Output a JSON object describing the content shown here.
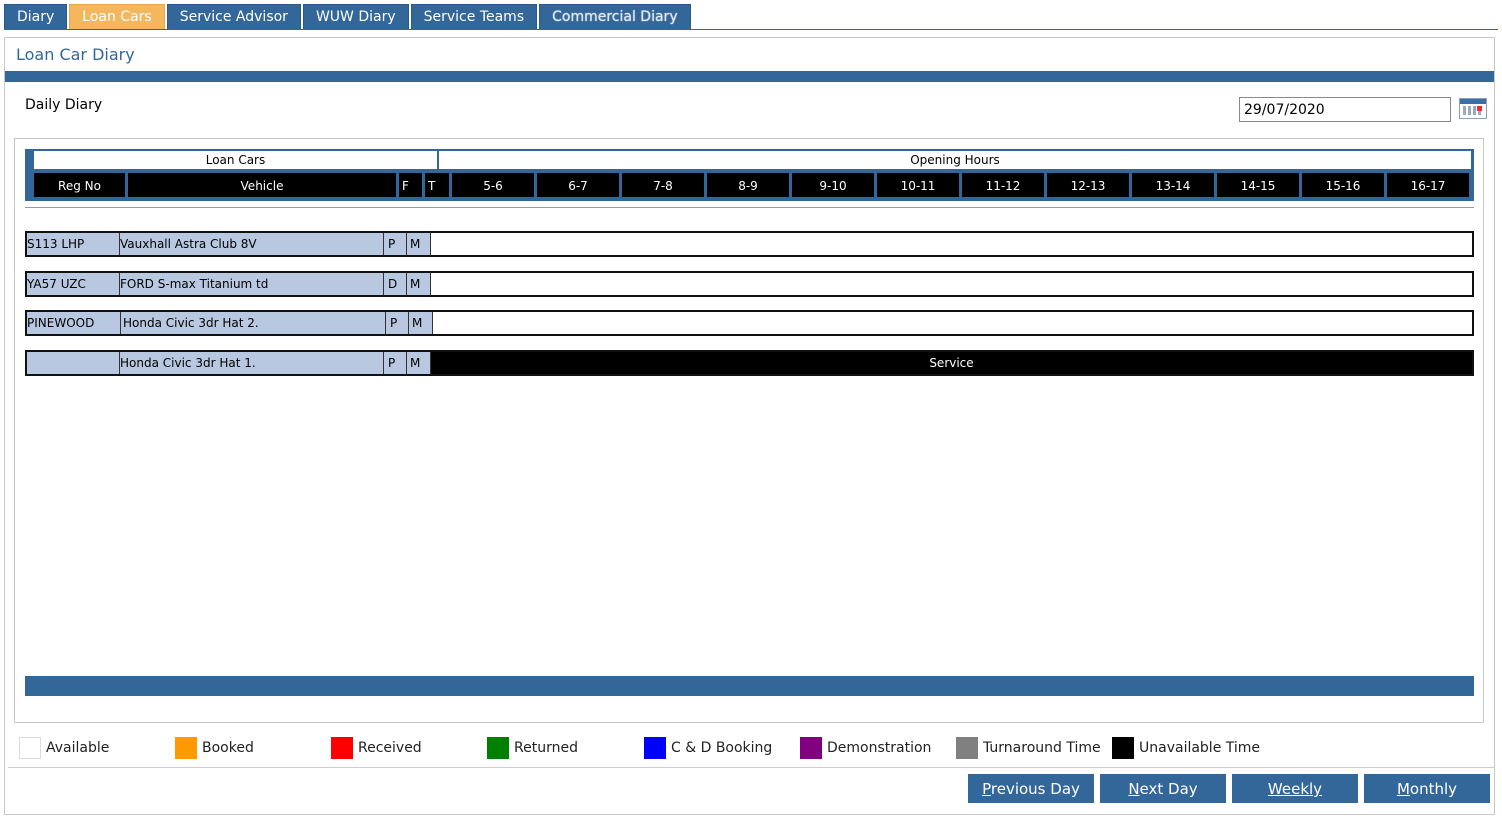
{
  "tabs": [
    {
      "label": "Diary",
      "active": false
    },
    {
      "label": "Loan Cars",
      "active": true
    },
    {
      "label": "Service Advisor",
      "active": false
    },
    {
      "label": "WUW Diary",
      "active": false
    },
    {
      "label": "Service Teams",
      "active": false
    },
    {
      "label": "Commercial Diary",
      "active": false
    }
  ],
  "page_title": "Loan Car Diary",
  "daily_label": "Daily Diary",
  "date_value": "29/07/2020",
  "header": {
    "group_loan_cars": "Loan Cars",
    "group_opening_hours": "Opening Hours",
    "columns": {
      "reg_no": "Reg No",
      "vehicle": "Vehicle",
      "f": "F",
      "t": "T"
    },
    "hours": [
      "5-6",
      "6-7",
      "7-8",
      "8-9",
      "9-10",
      "10-11",
      "11-12",
      "12-13",
      "13-14",
      "14-15",
      "15-16",
      "16-17"
    ]
  },
  "rows": [
    {
      "reg": "S113 LHP",
      "vehicle": "Vauxhall Astra Club 8V",
      "f": "P",
      "t": "M",
      "booking": ""
    },
    {
      "reg": "YA57 UZC",
      "vehicle": "FORD S-max Titanium td",
      "f": "D",
      "t": "M",
      "booking": ""
    },
    {
      "reg": "PINEWOOD",
      "vehicle": "Honda Civic 3dr Hat 2.",
      "f": "P",
      "t": "M",
      "booking": ""
    },
    {
      "reg": "",
      "vehicle": "Honda Civic 3dr Hat 1.",
      "f": "P",
      "t": "M",
      "booking": "Service"
    }
  ],
  "legend": [
    {
      "label": "Available",
      "color": "#ffffff"
    },
    {
      "label": "Booked",
      "color": "#ff9900"
    },
    {
      "label": "Received",
      "color": "#ff0000"
    },
    {
      "label": "Returned",
      "color": "#008000"
    },
    {
      "label": "C & D Booking",
      "color": "#0000ff"
    },
    {
      "label": "Demonstration",
      "color": "#800080"
    },
    {
      "label": "Turnaround Time",
      "color": "#808080"
    },
    {
      "label": "Unavailable Time",
      "color": "#000000"
    }
  ],
  "buttons": {
    "previous_day": {
      "key": "P",
      "rest": "revious Day"
    },
    "next_day": {
      "key": "N",
      "rest": "ext Day"
    },
    "weekly": {
      "key": "W",
      "rest": "eekly"
    },
    "monthly": {
      "key": "M",
      "rest": "onthly"
    }
  },
  "colors": {
    "brand": "#336699",
    "active_tab": "#f5b75d",
    "row_fill": "#b8c8e0"
  }
}
